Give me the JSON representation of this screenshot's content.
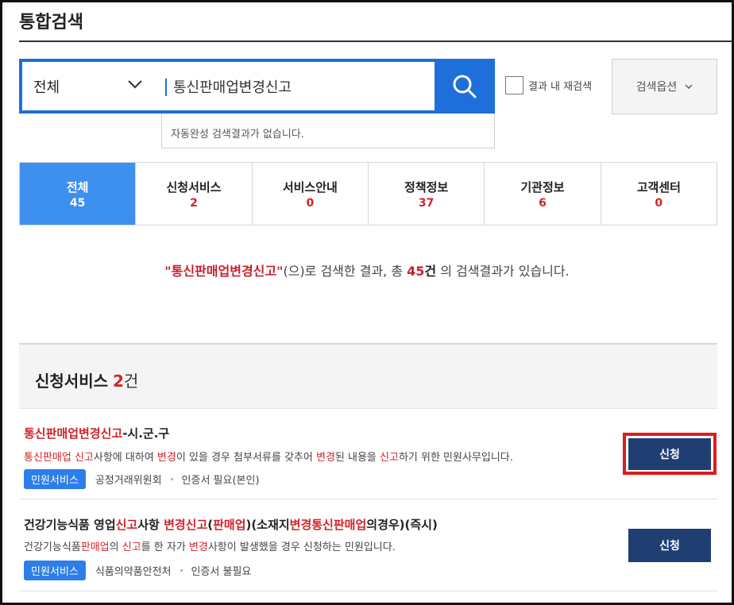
{
  "page": {
    "title": "통합검색"
  },
  "search": {
    "scope": "전체",
    "query": "통신판매업변경신고",
    "autocomplete_message": "자동완성 검색결과가 없습니다.",
    "research_label": "결과 내 재검색",
    "options_label": "검색옵션"
  },
  "tabs": [
    {
      "label": "전체",
      "count": "45",
      "active": true
    },
    {
      "label": "신청서비스",
      "count": "2"
    },
    {
      "label": "서비스안내",
      "count": "0"
    },
    {
      "label": "정책정보",
      "count": "37"
    },
    {
      "label": "기관정보",
      "count": "6"
    },
    {
      "label": "고객센터",
      "count": "0"
    }
  ],
  "summary": {
    "keyword": "\"통신판매업변경신고\"",
    "text_a": "(으)로 검색한 결과, 총 ",
    "count": "45",
    "unit": "건",
    "text_b": " 의 검색결과가 있습니다."
  },
  "section": {
    "title": "신청서비스",
    "count": "2",
    "unit": "건"
  },
  "results": [
    {
      "title_hl": "통신판매업변경신고",
      "title_rest": "-시.군.구",
      "desc": [
        {
          "t": "통신판매업",
          "h": true
        },
        {
          "t": " "
        },
        {
          "t": "신고",
          "h": true
        },
        {
          "t": "사항에 대하여 "
        },
        {
          "t": "변경",
          "h": true
        },
        {
          "t": "이 있을 경우 첨부서류를 갖추어 "
        },
        {
          "t": "변경",
          "h": true
        },
        {
          "t": "된 내용을 "
        },
        {
          "t": "신고",
          "h": true
        },
        {
          "t": "하기 위한 민원사무입니다."
        }
      ],
      "badge": "민원서비스",
      "org": "공정거래위원회",
      "cert": "인증서 필요(본인)",
      "button": "신청"
    },
    {
      "title_parts": [
        {
          "t": "건강기능식품 영업"
        },
        {
          "t": "신고",
          "h": true
        },
        {
          "t": "사항 "
        },
        {
          "t": "변경신고",
          "h": true
        },
        {
          "t": "("
        },
        {
          "t": "판매업",
          "h": true
        },
        {
          "t": ")(소재지"
        },
        {
          "t": "변경통신판매업",
          "h": true
        },
        {
          "t": "의경우)(즉시)"
        }
      ],
      "desc": [
        {
          "t": "건강기능식품"
        },
        {
          "t": "판매업",
          "h": true
        },
        {
          "t": "의 "
        },
        {
          "t": "신고",
          "h": true
        },
        {
          "t": "를 한 자가 "
        },
        {
          "t": "변경",
          "h": true
        },
        {
          "t": "사항이 발생했을 경우 신청하는 민원입니다."
        }
      ],
      "badge": "민원서비스",
      "org": "식품의약품안전처",
      "cert": "인증서 불필요",
      "button": "신청"
    }
  ],
  "colors": {
    "accent": "#1e6fd9",
    "active_tab": "#3d8ff0",
    "highlight": "#d2232a",
    "apply_button": "#1f3f73",
    "callout_border": "#e01b1b"
  }
}
